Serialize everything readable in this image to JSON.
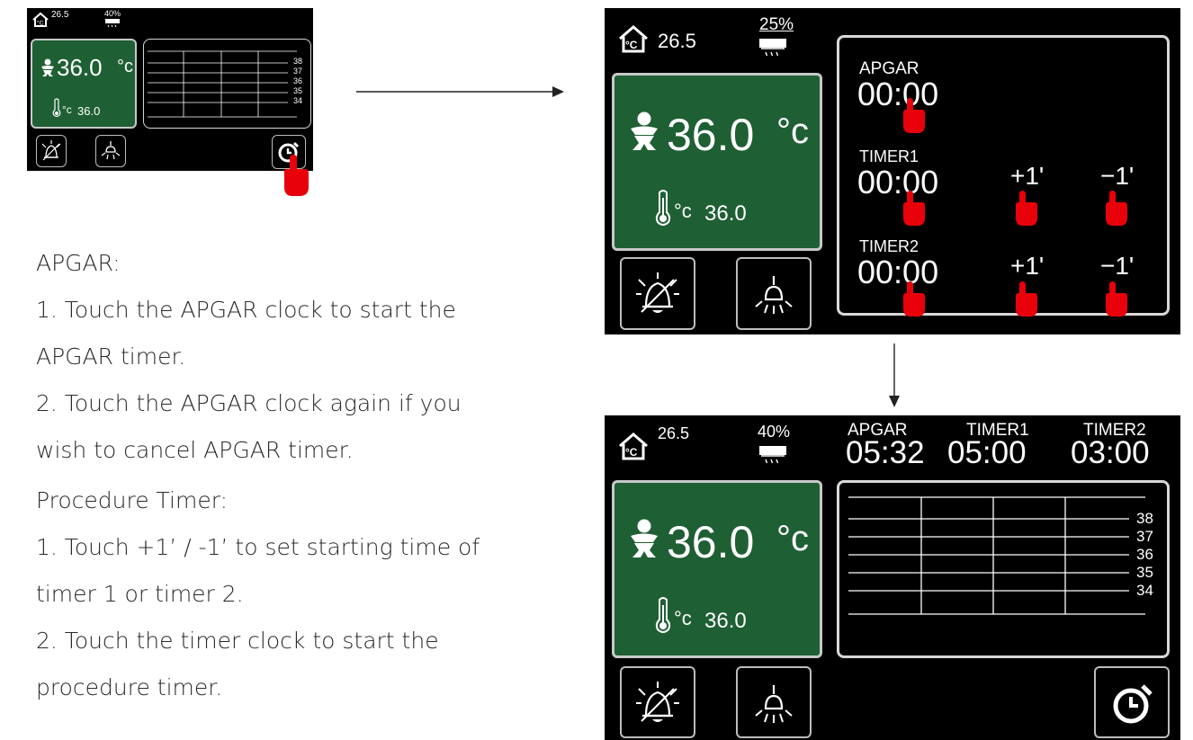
{
  "small_screen": {
    "room_temp": "26.5",
    "humidity": "40%",
    "baby_temp": "36.0",
    "baby_unit": "°c",
    "set_temp": "36.0",
    "set_unit": "°c",
    "scale": [
      "38",
      "37",
      "36",
      "35",
      "34"
    ]
  },
  "timer_screen": {
    "room_temp": "26.5",
    "humidity": "25%",
    "baby_temp": "36.0",
    "baby_unit": "°c",
    "set_temp": "36.0",
    "set_unit": "°c",
    "apgar_label": "APGAR",
    "apgar_time": "00:00",
    "timer1_label": "TIMER1",
    "timer1_time": "00:00",
    "timer2_label": "TIMER2",
    "timer2_time": "00:00",
    "plus_label": "+1'",
    "minus_label": "−1'"
  },
  "running_screen": {
    "room_temp": "26.5",
    "humidity": "40%",
    "apgar_label": "APGAR",
    "apgar_time": "05:32",
    "timer1_label": "TIMER1",
    "timer1_time": "05:00",
    "timer2_label": "TIMER2",
    "timer2_time": "03:00",
    "baby_temp": "36.0",
    "baby_unit": "°c",
    "set_temp": "36.0",
    "set_unit": "°c",
    "scale": [
      "38",
      "37",
      "36",
      "35",
      "34"
    ]
  },
  "instructions": {
    "apgar_heading": "APGAR:",
    "apgar_step1_line1": "1. Touch the APGAR clock to start the",
    "apgar_step1_line2": "APGAR timer.",
    "apgar_step2_line1": "2. Touch the APGAR clock again if you",
    "apgar_step2_line2": "wish to cancel APGAR timer.",
    "proc_heading": "Procedure Timer:",
    "proc_step1_line1": "1. Touch +1’ / -1’ to set starting time of",
    "proc_step1_line2": "timer 1 or timer 2.",
    "proc_step2_line1": "2. Touch the timer clock to start the",
    "proc_step2_line2": "procedure timer."
  },
  "icons": [
    "home-thermometer-icon",
    "air-heater-icon",
    "baby-icon",
    "thermometer-icon",
    "alarm-bell-icon",
    "lamp-icon",
    "timer-clock-icon",
    "hand-pointer-icon",
    "arrow-right-icon",
    "arrow-down-icon"
  ],
  "colors": {
    "panel_green": "#1f5f34",
    "screen_bg": "#000000",
    "pointer_red": "#e8000a"
  }
}
